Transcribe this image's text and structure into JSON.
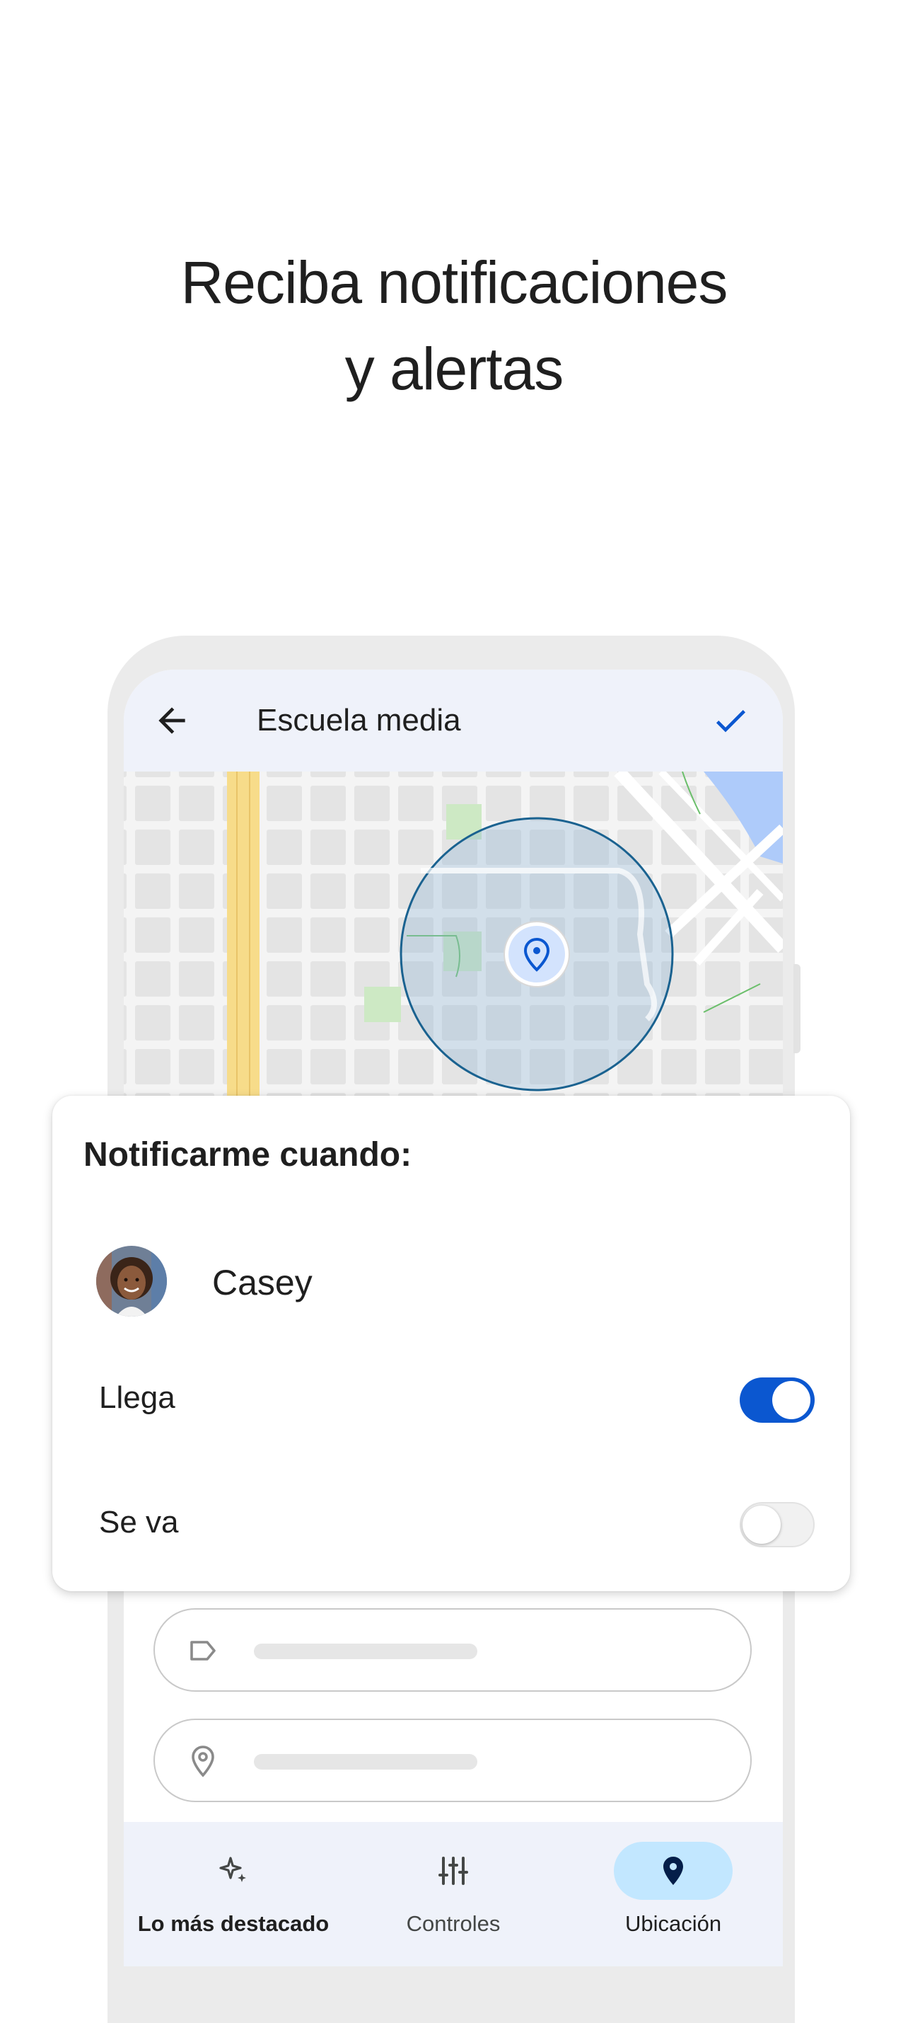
{
  "headline": {
    "line1": "Reciba notificaciones",
    "line2": "y alertas"
  },
  "appbar": {
    "back_icon": "arrow-back-icon",
    "title": "Escuela media",
    "confirm_icon": "check-icon"
  },
  "map": {
    "pin_icon": "location-pin-icon"
  },
  "card": {
    "title": "Notificarme cuando:",
    "person": {
      "name": "Casey",
      "avatar_icon": "avatar-photo"
    },
    "options": [
      {
        "label": "Llega",
        "enabled": true
      },
      {
        "label": "Se va",
        "enabled": false
      }
    ]
  },
  "form": {
    "label_field_icon": "label-tag-icon",
    "address_field_icon": "location-outline-icon"
  },
  "bottom_nav": {
    "items": [
      {
        "label": "Lo más destacado",
        "icon": "sparkle-icon",
        "active": false
      },
      {
        "label": "Controles",
        "icon": "sliders-icon",
        "active": false
      },
      {
        "label": "Ubicación",
        "icon": "location-pin-icon",
        "active": true
      }
    ]
  },
  "colors": {
    "accent_blue": "#0b57d0",
    "nav_active_bg": "#c2e7ff",
    "geofence_stroke": "#1a6290",
    "map_highway": "#f7dc8a"
  }
}
